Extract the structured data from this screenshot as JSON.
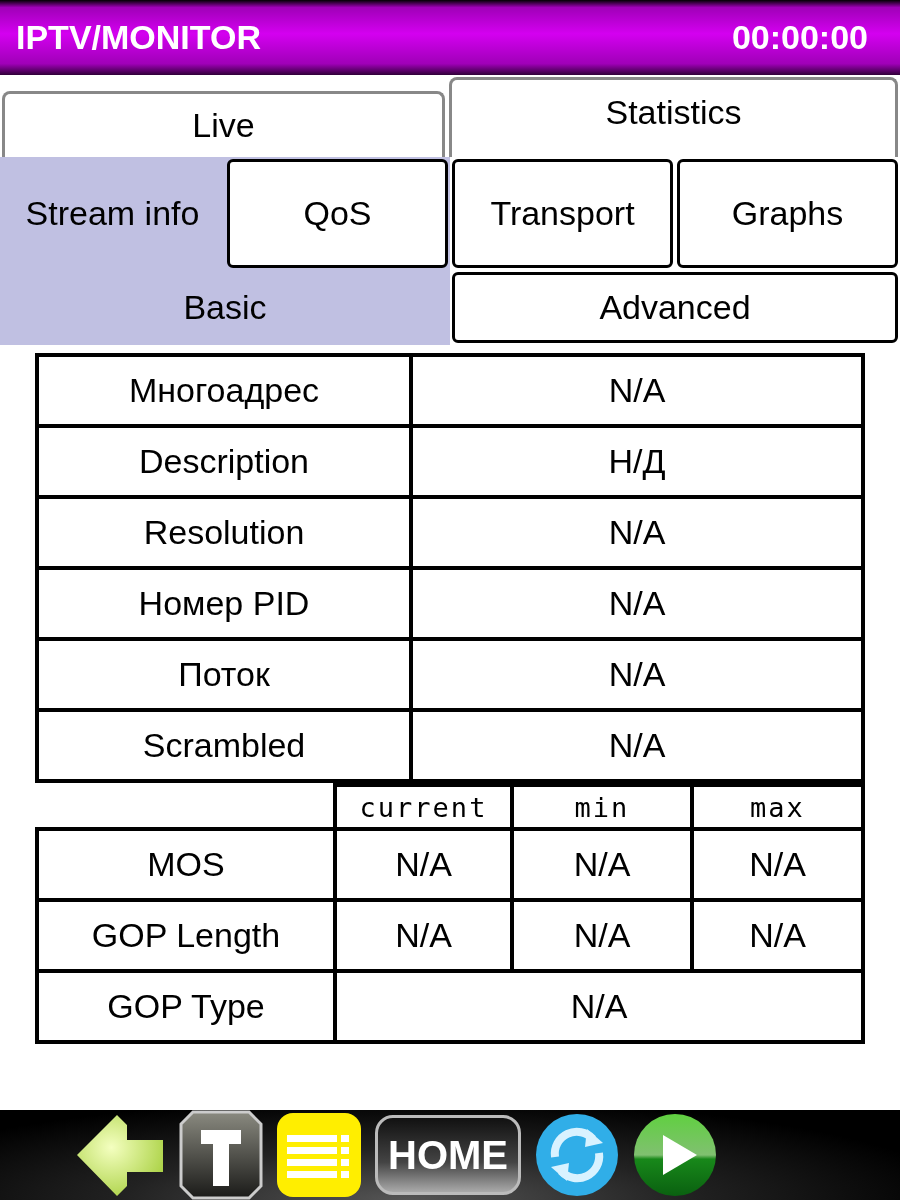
{
  "header": {
    "title": "IPTV/MONITOR",
    "clock": "00:00:00"
  },
  "tabs": [
    {
      "label": "Live",
      "selected": false
    },
    {
      "label": "Statistics",
      "selected": true
    }
  ],
  "subtabs": [
    {
      "label": "Stream info",
      "selected": true
    },
    {
      "label": "QoS",
      "selected": false
    },
    {
      "label": "Transport",
      "selected": false
    },
    {
      "label": "Graphs",
      "selected": false
    }
  ],
  "views": [
    {
      "label": "Basic",
      "selected": true
    },
    {
      "label": "Advanced",
      "selected": false
    }
  ],
  "info_table": [
    {
      "label": "Многоадрес",
      "value": "N/A"
    },
    {
      "label": "Description",
      "value": "Н/Д"
    },
    {
      "label": "Resolution",
      "value": "N/A"
    },
    {
      "label": "Номер PID",
      "value": "N/A"
    },
    {
      "label": "Поток",
      "value": "N/A"
    },
    {
      "label": "Scrambled",
      "value": "N/A"
    }
  ],
  "qos_table": {
    "columns": [
      "current",
      "min",
      "max"
    ],
    "rows": [
      {
        "label": "MOS",
        "values": [
          "N/A",
          "N/A",
          "N/A"
        ]
      },
      {
        "label": "GOP Length",
        "values": [
          "N/A",
          "N/A",
          "N/A"
        ]
      },
      {
        "label": "GOP Type",
        "values": [
          "N/A"
        ]
      }
    ]
  },
  "toolbar": {
    "home_label": "HOME"
  }
}
